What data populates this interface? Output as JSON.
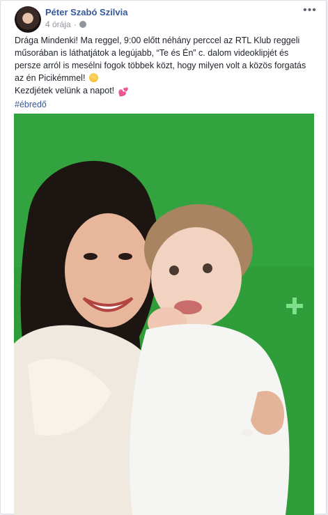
{
  "post": {
    "author": "Péter Szabó Szilvia",
    "timestamp": "4 órája",
    "separator": "·",
    "menu_icon": "more-options-icon",
    "text_line1": "Drága Mindenki! Ma reggel, 9:00 előtt néhány perccel az RTL Klub reggeli",
    "text_line2": "műsorában is láthatjátok a legújabb, “Te és Én” c. dalom videoklipjét és",
    "text_line3": "persze arról is mesélni fogok többek közt, hogy milyen volt a közös forgatás",
    "text_line4": "az én Picikémmel!",
    "text_line5": "Kezdjétek velünk a napot!",
    "hashtag": "#ébredő",
    "emoji1": "grinning-face-icon",
    "emoji2": "hearts-icon"
  },
  "colors": {
    "link": "#365899",
    "text": "#1d2129",
    "meta": "#90949c",
    "green_screen": "#2f9e3a"
  }
}
